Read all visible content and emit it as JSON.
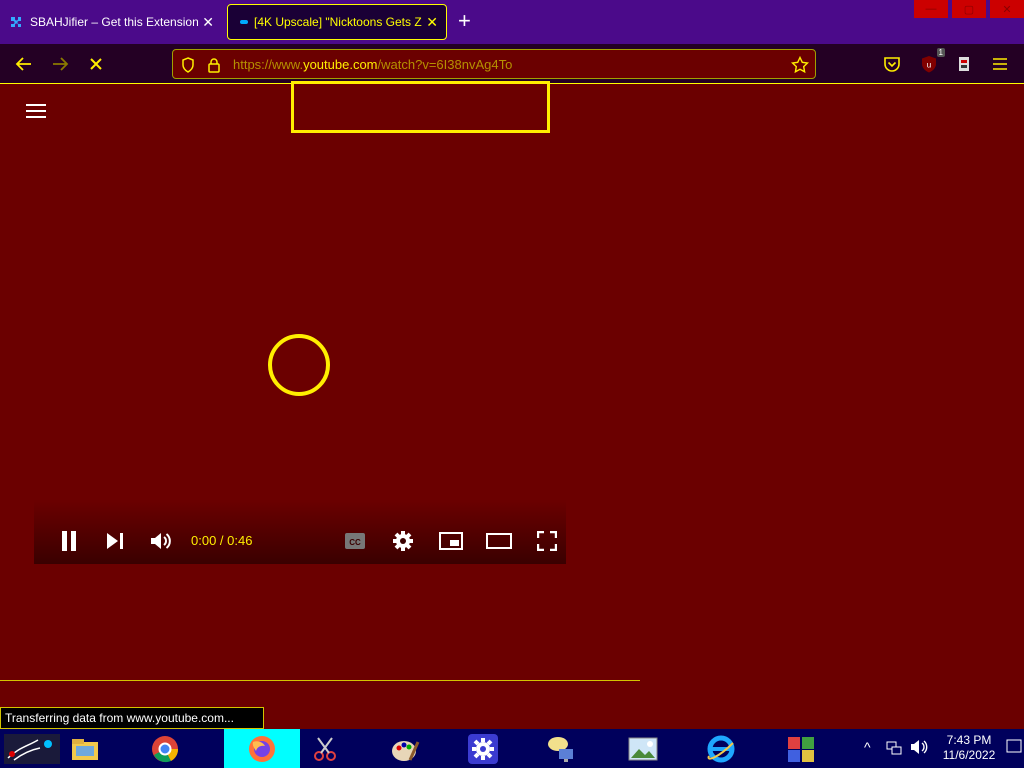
{
  "browser": {
    "tabs": [
      {
        "title": "SBAHJifier – Get this Extension f",
        "active": false
      },
      {
        "title": "[4K Upscale] \"Nicktoons Gets Z",
        "active": true
      }
    ],
    "close_glyph": "✕",
    "new_tab_glyph": "+",
    "url": {
      "prefix": "https://www.",
      "host": "youtube.com",
      "path": "/watch?v=6I38nvAg4To"
    },
    "extension_badge": "1",
    "colors": {
      "tabstrip": "#4b0a8a",
      "toolbar": "#240024",
      "page_bg": "#6b0000",
      "accent": "#ffee00"
    }
  },
  "player": {
    "time": "0:00 / 0:46"
  },
  "status": {
    "text": "Transferring data from www.youtube.com..."
  },
  "taskbar": {
    "clock_time": "7:43 PM",
    "clock_date": "11/6/2022",
    "icons": [
      "start-icon",
      "file-explorer-icon",
      "chrome-icon",
      "firefox-icon",
      "snipping-tool-icon",
      "paint-icon",
      "settings-icon",
      "network-icon",
      "photos-icon",
      "internet-explorer-icon",
      "control-panel-icon"
    ]
  }
}
